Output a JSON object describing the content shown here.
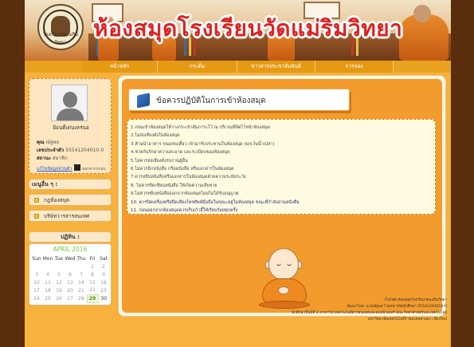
{
  "header": {
    "site_title": "ห้องสมุดโรงเรียนวัดแม่ริมวิทยา",
    "logo_text": "โรงเรียนวัดแม่ริมวิทยา"
  },
  "nav": {
    "items": [
      {
        "label": "หน้าหลัก"
      },
      {
        "label": "กระดิ่ม"
      },
      {
        "label": "ข่าวสารประชาสัมพันธ์"
      },
      {
        "label": "การจอง"
      }
    ]
  },
  "profile": {
    "caption": "ย้อนดีเด่นเหร่นอ",
    "name_label": "คุณ",
    "name_value": "ณัฐพล",
    "id_label": "เลขประจำตัว",
    "id_value": "55541204010-0",
    "status_label": "สถานะ",
    "status_value": "สมาชิก",
    "edit_link": "แก้ไขข้อมูลส่วนตัว",
    "logout_label": "ออกจากระบบ"
  },
  "menu": {
    "title": "เมนูอื่น ๆ :",
    "items": [
      {
        "label": "กฎห้องสมุด"
      },
      {
        "label": "บริษัทวารสารสนเทศ"
      }
    ]
  },
  "calendar": {
    "heading": "ปฏิทิน :",
    "month_label": "APRIL 2016",
    "weekdays": [
      "Sun",
      "Mon",
      "Tue",
      "Wed",
      "Thu",
      "Fri",
      "Sat"
    ],
    "today": "29"
  },
  "main": {
    "title": "ข้อควรปฏิบัติในการเข้าห้องสมุด",
    "rules": [
      "1.ก่อนเข้าห้องสมุดให้วางกระเป๋าสัมภาระไว้ ณ บริเวณที่จัดไว้หน้าห้องสมุด",
      "2.ไม่ส่งเสียงดังในห้องสมุด",
      "3.ห้ามนำอาหาร ขนมขบเคี้ยว เข้ามารับประทานในห้องสมุด (ยกเว้นน้ำเปล่า)",
      "4.ช่วยกันรักษาความสะอาด และระเบียบของห้องสมุด",
      "5.ไม่ควรส่งเสียงดังรบกวนผู้อื่น",
      "6.ไม่ควรฉีกหนังสือ กรีดหนังสือ หรือเอกสารในห้องสมุด",
      "7.ควรหยิบหนังสือหรือเอกสารในห้องสมุดด้วยความระมัดระวัง",
      "8. ไม่ควรขีดเขียนหนังสือ ให้เกิดความเสียหาย",
      "9.ไม่ควรหยิบหนังสือออกจากห้องสมุดโดยไม่ได้รับอนุญาต",
      "10. ควรปิดเครื่องหรือปิดเสียงโทรศัพท์มือถือในขณะอยู่ในห้องสมุด ขณะที่กำลังอ่านหนังสือ",
      "11. ก่อนออกจากห้องสมุดควรเก็บเก้าอี้ให้เรียบร้อยทุกครั้ง"
    ]
  },
  "footer": {
    "lines": [
      "เว็บไซต์ ห้องสมุดโรงเรียนวัดแม่ริมวิทยา",
      "พัฒนาโดย: นายณัฐพล ไวพจน์ รหัสนักศึกษา 55541204010-0",
      "นักศึกษาชั้นปีที่ 4 สาขาวิชาเทคโนโลยีสารสนเทศและคอมพิวเตอร์ คณะวิทยาศาสตร์และเทคโนโลยี",
      "มหาวิทยาลัยเทคโนโลยีราชมงคลล้านนา เชียงใหม่"
    ]
  },
  "colors": {
    "page_bg": "#5a2e0c",
    "content_bg": "#f7b13c",
    "nav_bg": "#e59a14",
    "title_red": "#e02020",
    "calendar_month": "#7bbf3a"
  }
}
